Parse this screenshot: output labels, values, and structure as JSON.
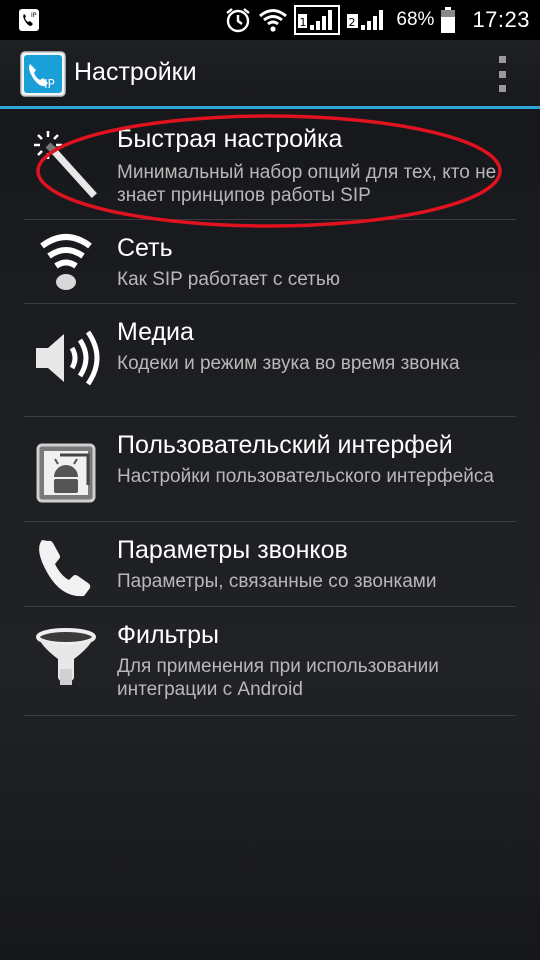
{
  "statusbar": {
    "battery_pct": "68%",
    "time": "17:23",
    "sim1_label": "1",
    "sim2_label": "2",
    "icons": [
      "sip-phone-icon",
      "alarm-icon",
      "wifi-icon",
      "signal-sim1-icon",
      "signal-sim2-icon",
      "battery-icon"
    ]
  },
  "actionbar": {
    "title": "Настройки",
    "app_icon": "sip-phone-app-icon",
    "app_icon_text": "IP",
    "overflow_icon": "overflow-menu-icon"
  },
  "items": [
    {
      "title": "Быстрая настройка",
      "summary": "Минимальный набор опций для тех, кто не знает принципов работы SIP",
      "icon": "magic-wand-icon"
    },
    {
      "title": "Сеть",
      "summary": "Как SIP работает с сетью",
      "icon": "wifi-icon"
    },
    {
      "title": "Медиа",
      "summary": "Кодеки и режим звука во время звонка",
      "icon": "speaker-icon"
    },
    {
      "title": "Пользовательский интерфей",
      "summary": "Настройки пользовательского интерфейса",
      "icon": "android-interface-icon"
    },
    {
      "title": "Параметры звонков",
      "summary": "Параметры, связанные со звонками",
      "icon": "phone-handset-icon"
    },
    {
      "title": "Фильтры",
      "summary": "Для применения при использовании интеграции с Android",
      "icon": "filter-funnel-icon"
    }
  ],
  "colors": {
    "accent": "#2fa4d6",
    "highlight_ellipse": "#e0121f",
    "summary_text": "#b8b8b8"
  }
}
